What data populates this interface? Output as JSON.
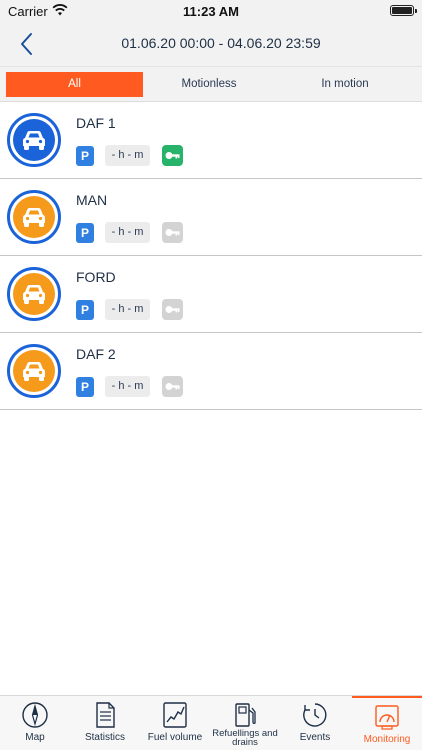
{
  "status_bar": {
    "carrier": "Carrier",
    "time": "11:23 AM"
  },
  "header": {
    "title": "01.06.20 00:00 - 04.06.20 23:59"
  },
  "tabs": [
    {
      "label": "All",
      "active": true
    },
    {
      "label": "Motionless",
      "active": false
    },
    {
      "label": "In motion",
      "active": false
    }
  ],
  "vehicles": [
    {
      "name": "DAF 1",
      "avatar_color": "blue",
      "status_badge": "P",
      "duration": "- h - m",
      "ignition": "on"
    },
    {
      "name": "MAN",
      "avatar_color": "orange",
      "status_badge": "P",
      "duration": "- h - m",
      "ignition": "off"
    },
    {
      "name": "FORD",
      "avatar_color": "orange",
      "status_badge": "P",
      "duration": "- h - m",
      "ignition": "off"
    },
    {
      "name": "DAF 2",
      "avatar_color": "orange",
      "status_badge": "P",
      "duration": "- h - m",
      "ignition": "off"
    }
  ],
  "bottom_nav": [
    {
      "label": "Map",
      "icon": "compass-icon",
      "active": false
    },
    {
      "label": "Statistics",
      "icon": "document-icon",
      "active": false
    },
    {
      "label": "Fuel volume",
      "icon": "chart-icon",
      "active": false
    },
    {
      "label": "Refuellings and drains",
      "icon": "fuel-pump-icon",
      "active": false
    },
    {
      "label": "Events",
      "icon": "clock-icon",
      "active": false
    },
    {
      "label": "Monitoring",
      "icon": "monitor-icon",
      "active": true
    }
  ],
  "colors": {
    "accent": "#ff5a1f",
    "blue": "#1a63d8",
    "orange": "#f59a1b",
    "parking": "#2f80e0",
    "ignition_on": "#28b36a",
    "ignition_off": "#d3d3d3"
  }
}
